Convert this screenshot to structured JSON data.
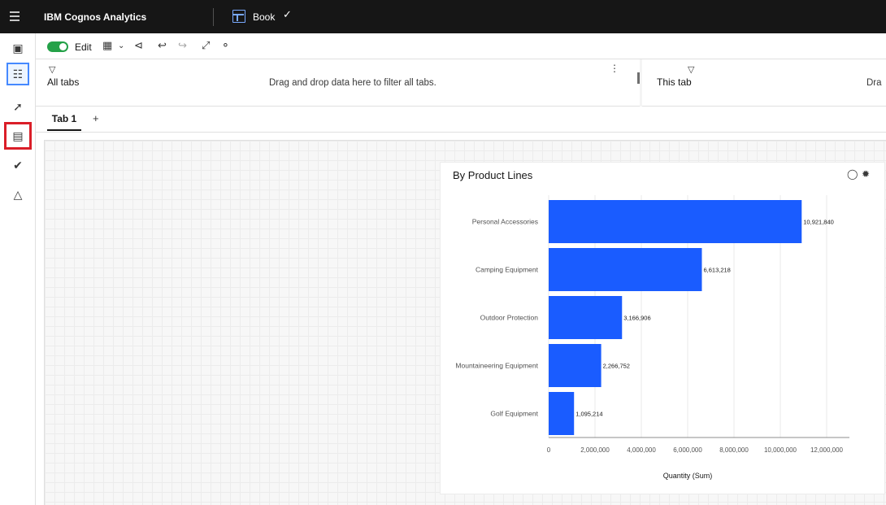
{
  "app": {
    "title": "IBM Cognos Analytics",
    "book_label": "Book"
  },
  "toolbar": {
    "edit_label": "Edit"
  },
  "filters": {
    "all_tabs_label": "All tabs",
    "all_tabs_hint": "Drag and drop data here to filter all tabs.",
    "this_tab_label": "This tab",
    "this_tab_hint": "Dra"
  },
  "tabs": [
    {
      "label": "Tab 1"
    }
  ],
  "tab_add_label": "+",
  "widget": {
    "title": "By Product Lines"
  },
  "colors": {
    "bar": "#1a5cff",
    "toggle": "#24a148",
    "topbar": "#161616"
  },
  "chart_data": {
    "type": "bar",
    "orientation": "horizontal",
    "title": "By Product Lines",
    "categories": [
      "Personal Accessories",
      "Camping Equipment",
      "Outdoor Protection",
      "Mountaineering Equipment",
      "Golf Equipment"
    ],
    "values": [
      10921840,
      6613218,
      3166906,
      2266752,
      1095214
    ],
    "value_labels": [
      "10,921,840",
      "6,613,218",
      "3,166,906",
      "2,266,752",
      "1,095,214"
    ],
    "xlabel": "Quantity (Sum)",
    "xlim": [
      0,
      12000000
    ],
    "x_ticks": [
      0,
      2000000,
      4000000,
      6000000,
      8000000,
      10000000,
      12000000
    ],
    "x_tick_labels": [
      "0",
      "2,000,000",
      "4,000,000",
      "6,000,000",
      "8,000,000",
      "10,000,000",
      "12,000,000"
    ],
    "grid": true
  }
}
